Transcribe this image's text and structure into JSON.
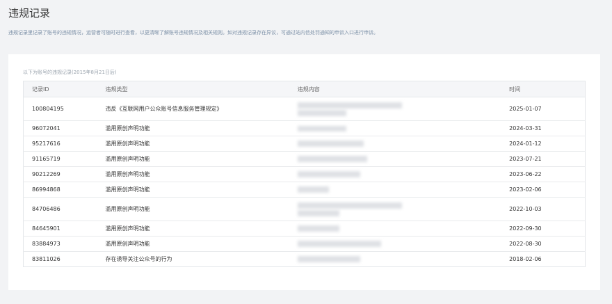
{
  "page": {
    "title": "违规记录",
    "description": "违规记录里记录了账号的违规情况，运营者可随时进行查看，以更清晰了解账号违规情况及相关规则。如对违规记录存在异议，可通过站内信处罚通知的申诉入口进行申诉。"
  },
  "table": {
    "caption": "以下为账号的违规记录(2015年8月21日后)",
    "headers": {
      "id": "记录ID",
      "type": "违规类型",
      "content": "违规内容",
      "time": "时间"
    },
    "rows": [
      {
        "id": "100804195",
        "type": "违反《互联网用户公众账号信息服务管理规定》",
        "time": "2025-01-07"
      },
      {
        "id": "96072041",
        "type": "滥用原创声明功能",
        "time": "2024-03-31"
      },
      {
        "id": "95217616",
        "type": "滥用原创声明功能",
        "time": "2024-01-12"
      },
      {
        "id": "91165719",
        "type": "滥用原创声明功能",
        "time": "2023-07-21"
      },
      {
        "id": "90212269",
        "type": "滥用原创声明功能",
        "time": "2023-06-22"
      },
      {
        "id": "86994868",
        "type": "滥用原创声明功能",
        "time": "2023-02-06"
      },
      {
        "id": "84706486",
        "type": "滥用原创声明功能",
        "time": "2022-10-03"
      },
      {
        "id": "84645901",
        "type": "滥用原创声明功能",
        "time": "2022-09-30"
      },
      {
        "id": "83884973",
        "type": "滥用原创声明功能",
        "time": "2022-08-30"
      },
      {
        "id": "83811026",
        "type": "存在诱导关注公众号的行为",
        "time": "2018-02-06"
      }
    ]
  },
  "colors": {
    "background": "#f2f3f5",
    "card": "#ffffff",
    "link": "#3b5998",
    "header_bg": "#f5f6f8"
  }
}
